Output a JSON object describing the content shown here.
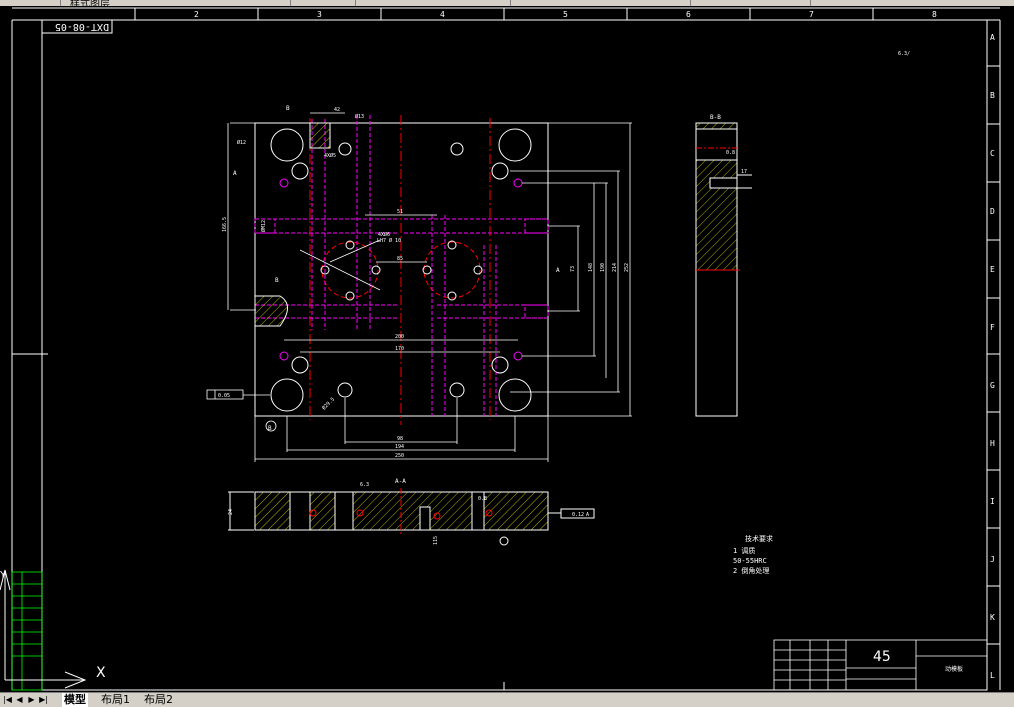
{
  "app": {
    "toolbar_title": "样式图层",
    "colors": {
      "background": "#000000",
      "line": "#ffffff",
      "dimension": "#ffffff",
      "center": "#ff0000",
      "hidden": "#ff00ff",
      "section": "#ffff00",
      "ui": "#d4d0c8"
    }
  },
  "drawing": {
    "drawing_number": "DXT-08-05",
    "column_labels": [
      "2",
      "3",
      "4",
      "5",
      "6",
      "7",
      "8"
    ],
    "row_labels": [
      "A",
      "B",
      "C",
      "D",
      "E",
      "F",
      "G",
      "H",
      "I",
      "J",
      "K",
      "L"
    ],
    "section_labels": {
      "b_top": "B",
      "b_mid": "B",
      "a_left": "A",
      "a_right": "A",
      "section_aa": "A-A",
      "section_bb": "B-B"
    },
    "dimensions": {
      "d42": "42",
      "d51": "51",
      "d85": "85",
      "d200": "200",
      "d170": "170",
      "d98": "98",
      "d194": "194",
      "d250": "250",
      "d73": "73",
      "d148": "148",
      "d190": "190",
      "d214": "214",
      "d252": "252",
      "d166": "166.5",
      "d17": "17",
      "d24": "24",
      "d115": "115"
    },
    "callouts": {
      "c1": "4XØ6",
      "c2": "LH7 Ø 10",
      "c3": "4XØ5",
      "c4": "Ø13",
      "c5": "ØM12",
      "c6": "Ø29.5",
      "c7": "Ø12"
    },
    "tolerances": {
      "flatness_left": "0.05",
      "parallel": "0.12",
      "datum": "A",
      "datum_b": "B"
    },
    "roughness": {
      "r1": "6.3",
      "r2": "0.8",
      "r3": "0.8",
      "r4": "0.8",
      "top_right": "6.3/"
    },
    "tech_notes": {
      "title": "技术要求",
      "line1": "1  调质",
      "line2": "50-55HRC",
      "line3": "2  倒角处理"
    },
    "title_block": {
      "material": "45",
      "name": "动模板"
    },
    "ucs": {
      "axis_y": "Y",
      "axis_x": "X"
    }
  },
  "tabs": [
    {
      "label": "模型",
      "active": true
    },
    {
      "label": "布局1",
      "active": false
    },
    {
      "label": "布局2",
      "active": false
    }
  ]
}
